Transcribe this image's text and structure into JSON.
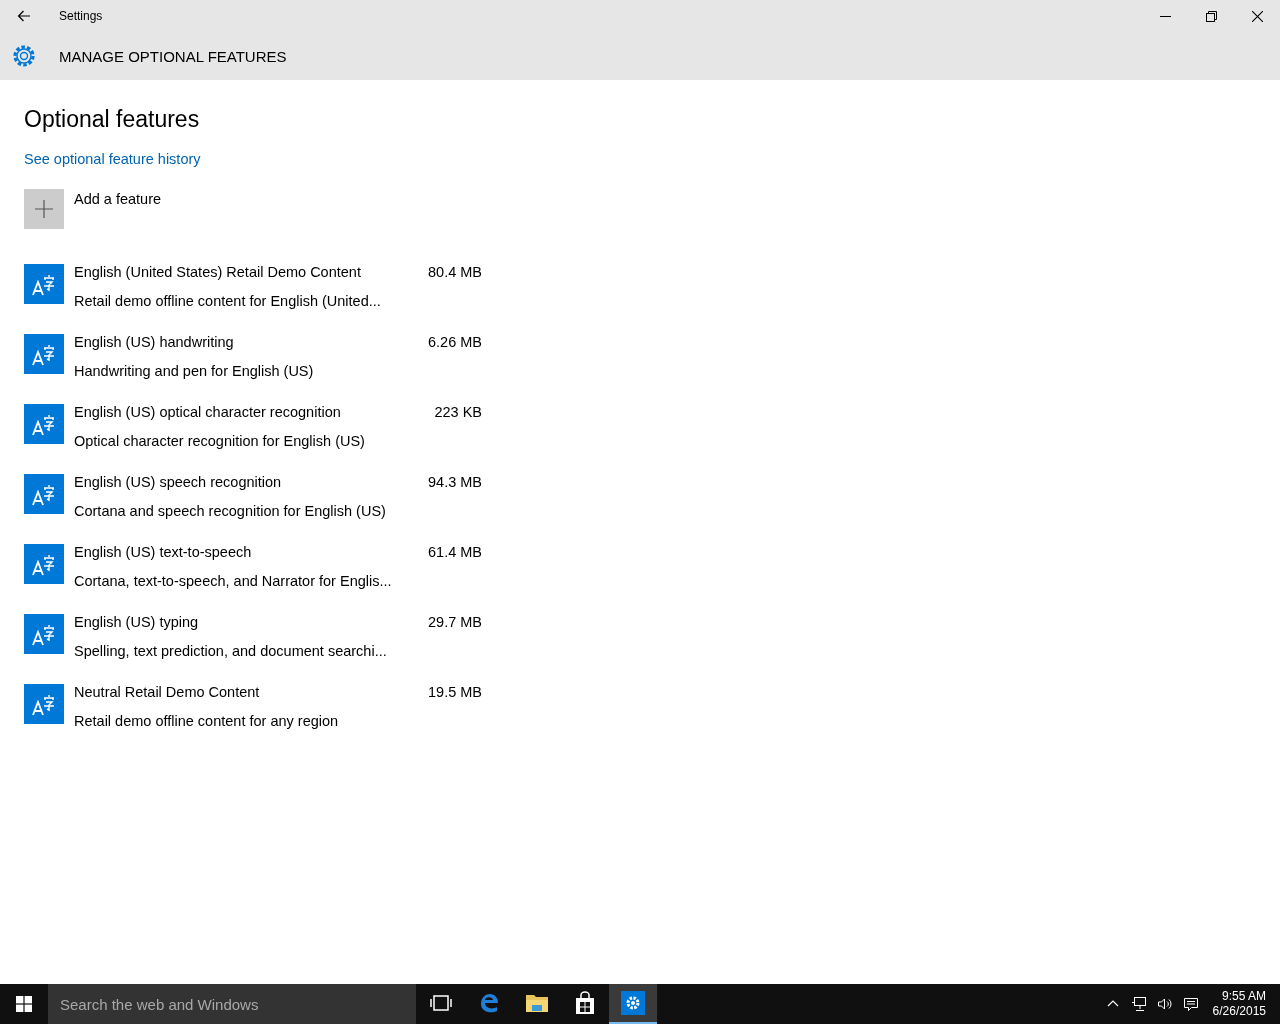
{
  "window": {
    "title": "Settings"
  },
  "header": {
    "title": "MANAGE OPTIONAL FEATURES"
  },
  "page": {
    "heading": "Optional features",
    "history_link": "See optional feature history",
    "add_feature": "Add a feature"
  },
  "features": [
    {
      "name": "English (United States) Retail Demo Content",
      "size": "80.4 MB",
      "description": "Retail demo offline content for English (United..."
    },
    {
      "name": "English (US) handwriting",
      "size": "6.26 MB",
      "description": "Handwriting and pen for English (US)"
    },
    {
      "name": "English (US) optical character recognition",
      "size": "223 KB",
      "description": "Optical character recognition for English (US)"
    },
    {
      "name": "English (US) speech recognition",
      "size": "94.3 MB",
      "description": "Cortana and speech recognition for English (US)"
    },
    {
      "name": "English (US) text-to-speech",
      "size": "61.4 MB",
      "description": "Cortana, text-to-speech, and Narrator for Englis..."
    },
    {
      "name": "English (US) typing",
      "size": "29.7 MB",
      "description": "Spelling, text prediction, and document searchi..."
    },
    {
      "name": "Neutral Retail Demo Content",
      "size": "19.5 MB",
      "description": "Retail demo offline content for any region"
    }
  ],
  "taskbar": {
    "search_placeholder": "Search the web and Windows",
    "apps": [
      {
        "kind": "taskview",
        "selected": false
      },
      {
        "kind": "edge",
        "selected": false
      },
      {
        "kind": "explorer",
        "selected": false
      },
      {
        "kind": "store",
        "selected": false
      },
      {
        "kind": "settings",
        "selected": true
      }
    ],
    "time": "9:55 AM",
    "date": "6/26/2015"
  }
}
